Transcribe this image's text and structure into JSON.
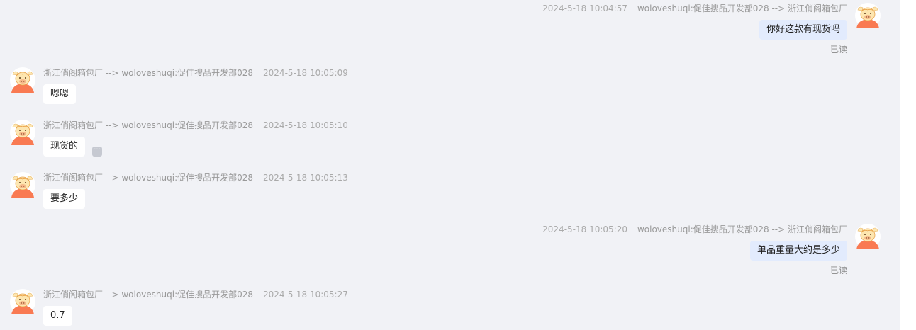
{
  "conversation": {
    "messages": [
      {
        "side": "right",
        "time": "2024-5-18 10:04:57",
        "route": "woloveshuqi:促佳搜品开发部028 --> 浙江俏阁箱包厂",
        "text": "你好这款有现货吗",
        "status": "已读"
      },
      {
        "side": "left",
        "route": "浙江俏阁箱包厂 --> woloveshuqi:促佳搜品开发部028",
        "time": "2024-5-18 10:05:09",
        "text": "嗯嗯"
      },
      {
        "side": "left",
        "route": "浙江俏阁箱包厂 --> woloveshuqi:促佳搜品开发部028",
        "time": "2024-5-18 10:05:10",
        "text": "现货的",
        "more_icon": "ellipsis-icon",
        "more_glyph": "···"
      },
      {
        "side": "left",
        "route": "浙江俏阁箱包厂 --> woloveshuqi:促佳搜品开发部028",
        "time": "2024-5-18 10:05:13",
        "text": "要多少"
      },
      {
        "side": "right",
        "time": "2024-5-18 10:05:20",
        "route": "woloveshuqi:促佳搜品开发部028 --> 浙江俏阁箱包厂",
        "text": "单品重量大约是多少",
        "status": "已读"
      },
      {
        "side": "left",
        "route": "浙江俏阁箱包厂 --> woloveshuqi:促佳搜品开发部028",
        "time": "2024-5-18 10:05:27",
        "text": "0.7"
      }
    ]
  },
  "avatar_icon": "cartoon-bull-avatar-icon",
  "colors": {
    "background": "#f1f2f6",
    "incoming_bubble": "#ffffff",
    "outgoing_bubble": "#e2ebfd",
    "avatar_orange": "#f97a52",
    "avatar_cream": "#fde6b0"
  }
}
